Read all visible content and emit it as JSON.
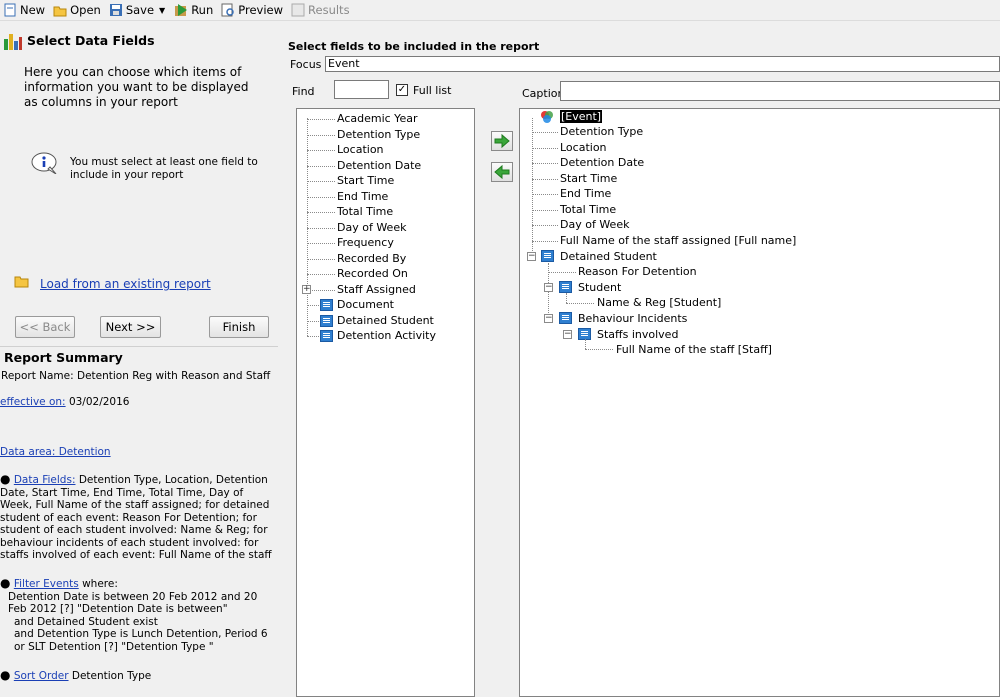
{
  "toolbar": {
    "new": "New",
    "open": "Open",
    "save": "Save",
    "run": "Run",
    "preview": "Preview",
    "results": "Results"
  },
  "wizard": {
    "title": "Select Data Fields",
    "description": "Here you can choose which items of information you want to be displayed as columns in your report",
    "note": "You must select at least one field to include in your report",
    "load_link": "Load from an existing report",
    "back": "<< Back",
    "next": "Next >>",
    "finish": "Finish"
  },
  "summary": {
    "title": "Report Summary",
    "report_name": "Report Name: Detention Reg with Reason and Staff",
    "effective_label": "effective on:",
    "effective_date": "03/02/2016",
    "data_area": "Data area: Detention",
    "fields_link": "Data Fields:",
    "fields_text": "Detention Type, Location, Detention Date, Start Time, End Time, Total Time, Day of Week, Full Name of the staff assigned; for detained student of each event: Reason For Detention; for student of each student involved: Name & Reg; for behaviour incidents of each student involved: for staffs involved of each event: Full Name of the staff",
    "filter_link": "Filter Events",
    "filter_where": "where:",
    "filter_line1": "Detention Date is between 20 Feb 2012 and 20 Feb 2012 [?] \"Detention Date is between\"",
    "filter_line2": "and Detained Student exist",
    "filter_line3": "and Detention Type is Lunch Detention, Period 6 or SLT Detention [?] \"Detention Type \"",
    "sort_link": "Sort Order",
    "sort_text": "Detention Type"
  },
  "main": {
    "title": "Select fields to be included in the report",
    "focus_label": "Focus",
    "focus_value": "Event",
    "find_label": "Find",
    "find_value": "",
    "full_list_label": "Full list",
    "full_list_checked": "✓",
    "caption_label": "Caption",
    "caption_value": ""
  },
  "left_tree": [
    "Academic Year",
    "Detention Type",
    "Location",
    "Detention Date",
    "Start Time",
    "End Time",
    "Total Time",
    "Day of Week",
    "Frequency",
    "Recorded By",
    "Recorded On",
    "Staff Assigned",
    "Document",
    "Detained Student",
    "Detention Activity"
  ],
  "right_tree": {
    "root": "[Event]",
    "fields": [
      "Detention Type",
      "Location",
      "Detention Date",
      "Start Time",
      "End Time",
      "Total Time",
      "Day of Week",
      "Full Name of the staff assigned [Full name]"
    ],
    "detained_student": "Detained Student",
    "reason": "Reason For Detention",
    "student": "Student",
    "name_reg": "Name & Reg [Student]",
    "behaviour": "Behaviour Incidents",
    "staffs": "Staffs involved",
    "staff_full_name": "Full Name of the staff [Staff]"
  },
  "colors": {
    "link": "#1a3fb5",
    "arrow_green": "#3aa63a",
    "selection": "#000000"
  }
}
